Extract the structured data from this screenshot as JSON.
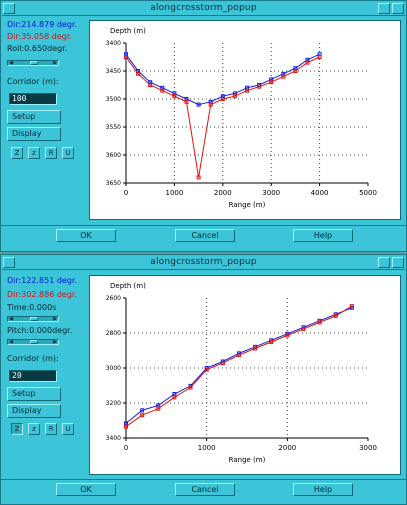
{
  "windows": [
    {
      "title": "alongcrosstorm_popup",
      "info": [
        {
          "text": "Dir:214.879 degr.",
          "color": "blue"
        },
        {
          "text": "Dir:35.058 degr.",
          "color": "red"
        },
        {
          "text": "Roll:0.650degr.",
          "color": "dark"
        }
      ],
      "corridor_label": "Corridor (m):",
      "corridor_value": "100",
      "setup_label": "Setup",
      "display_label": "Display",
      "zoom_buttons": [
        "Z",
        "z",
        "R",
        "U"
      ],
      "ok_label": "OK",
      "cancel_label": "Cancel",
      "help_label": "Help",
      "plot": {
        "ylabel": "Depth (m)",
        "xlabel": "Range (m)",
        "xticks": [
          "0",
          "1000",
          "2000",
          "3000",
          "4000",
          "5000"
        ],
        "yticks": [
          "3400",
          "3450",
          "3500",
          "3550",
          "3600",
          "3650"
        ]
      }
    },
    {
      "title": "alongcrosstorm_popup",
      "info": [
        {
          "text": "Dir:122.851 degr.",
          "color": "blue"
        },
        {
          "text": "Dir:302.886 degr.",
          "color": "red"
        },
        {
          "text": "Time:0.000s",
          "color": "dark"
        },
        {
          "text": "Pitch:0.000degr.",
          "color": "dark"
        }
      ],
      "corridor_label": "Corridor (m):",
      "corridor_value": "20",
      "setup_label": "Setup",
      "display_label": "Display",
      "zoom_buttons": [
        "Z",
        "z",
        "R",
        "U"
      ],
      "ok_label": "OK",
      "cancel_label": "Cancel",
      "help_label": "Help",
      "plot": {
        "ylabel": "Depth (m)",
        "xlabel": "Range (m)",
        "xticks": [
          "0",
          "1000",
          "2000",
          "3000"
        ],
        "yticks": [
          "2600",
          "2800",
          "3000",
          "3200",
          "3400"
        ]
      }
    }
  ],
  "chart_data": [
    {
      "type": "scatter",
      "xlabel": "Range (m)",
      "ylabel": "Depth (m)",
      "xlim": [
        0,
        5000
      ],
      "ylim": [
        3650,
        3400
      ],
      "grid": true,
      "series": [
        {
          "color": "#1020e0",
          "x": [
            0,
            250,
            500,
            750,
            1000,
            1250,
            1500,
            1750,
            2000,
            2250,
            2500,
            2750,
            3000,
            3250,
            3500,
            3750,
            4000
          ],
          "y": [
            3420,
            3450,
            3470,
            3480,
            3490,
            3500,
            3510,
            3505,
            3495,
            3490,
            3480,
            3475,
            3465,
            3455,
            3445,
            3430,
            3420
          ]
        },
        {
          "color": "#e01010",
          "x": [
            0,
            250,
            500,
            750,
            1000,
            1250,
            1500,
            1750,
            2000,
            2250,
            2500,
            2750,
            3000,
            3250,
            3500,
            3750,
            4000
          ],
          "y": [
            3425,
            3455,
            3475,
            3485,
            3495,
            3505,
            3640,
            3510,
            3500,
            3495,
            3485,
            3478,
            3470,
            3460,
            3450,
            3435,
            3425
          ]
        }
      ]
    },
    {
      "type": "scatter",
      "xlabel": "Range (m)",
      "ylabel": "Depth (m)",
      "xlim": [
        0,
        3000
      ],
      "ylim": [
        3420,
        2560
      ],
      "grid": true,
      "series": [
        {
          "color": "#1020e0",
          "x": [
            0,
            200,
            400,
            600,
            800,
            1000,
            1200,
            1400,
            1600,
            1800,
            2000,
            2200,
            2400,
            2600,
            2800
          ],
          "y": [
            3330,
            3250,
            3220,
            3150,
            3100,
            2990,
            2950,
            2900,
            2860,
            2820,
            2780,
            2740,
            2700,
            2660,
            2620
          ]
        },
        {
          "color": "#e01010",
          "x": [
            0,
            200,
            400,
            600,
            800,
            1000,
            1200,
            1400,
            1600,
            1800,
            2000,
            2200,
            2400,
            2600,
            2800
          ],
          "y": [
            3350,
            3280,
            3240,
            3170,
            3110,
            3000,
            2960,
            2910,
            2870,
            2830,
            2790,
            2750,
            2710,
            2670,
            2610
          ]
        }
      ]
    }
  ]
}
